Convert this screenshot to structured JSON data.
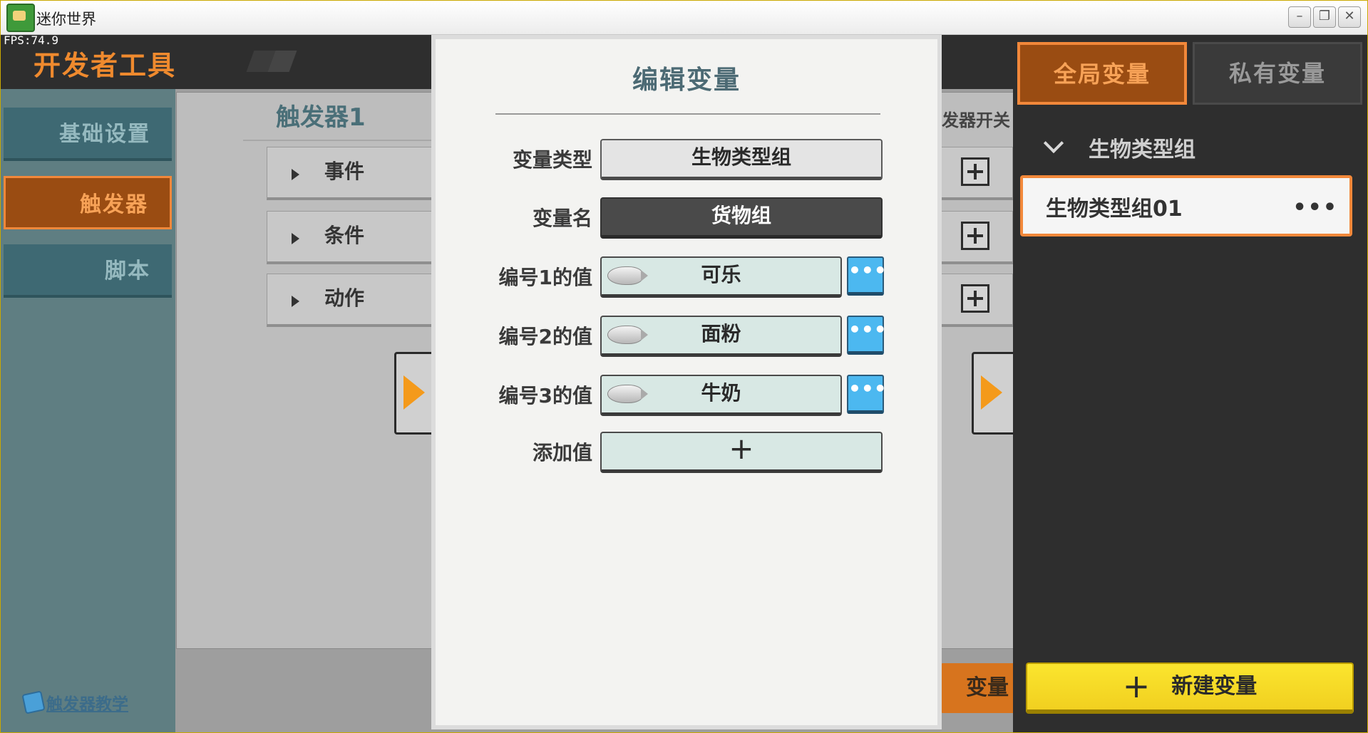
{
  "window": {
    "title": "迷你世界",
    "fps": "FPS:74.9"
  },
  "header": {
    "title": "开发者工具"
  },
  "nav": {
    "items": [
      "基础设置",
      "触发器",
      "脚本"
    ],
    "active": "触发器",
    "tutorial": "触发器教学"
  },
  "trigger": {
    "name": "触发器1",
    "rows": [
      "事件",
      "条件",
      "动作"
    ],
    "switch_label": "发器开关",
    "variable_button": "变量"
  },
  "modal": {
    "title": "编辑变量",
    "type_label": "变量类型",
    "type_value": "生物类型组",
    "name_label": "变量名",
    "name_value": "货物组",
    "values": [
      {
        "label": "编号1的值",
        "value": "可乐"
      },
      {
        "label": "编号2的值",
        "value": "面粉"
      },
      {
        "label": "编号3的值",
        "value": "牛奶"
      }
    ],
    "add_label": "添加值",
    "add_symbol": "+",
    "more_symbol": "•••"
  },
  "right": {
    "tabs": [
      "全局变量",
      "私有变量"
    ],
    "active_tab": "全局变量",
    "group": "生物类型组",
    "items": [
      {
        "label": "生物类型组01",
        "more": "•••"
      }
    ],
    "new_button": "新建变量",
    "new_plus": "+"
  },
  "colors": {
    "accent": "#f2883a",
    "active_bg": "#9a4c12",
    "blue_button": "#4cb8f0",
    "new_button": "#fbe52e"
  }
}
